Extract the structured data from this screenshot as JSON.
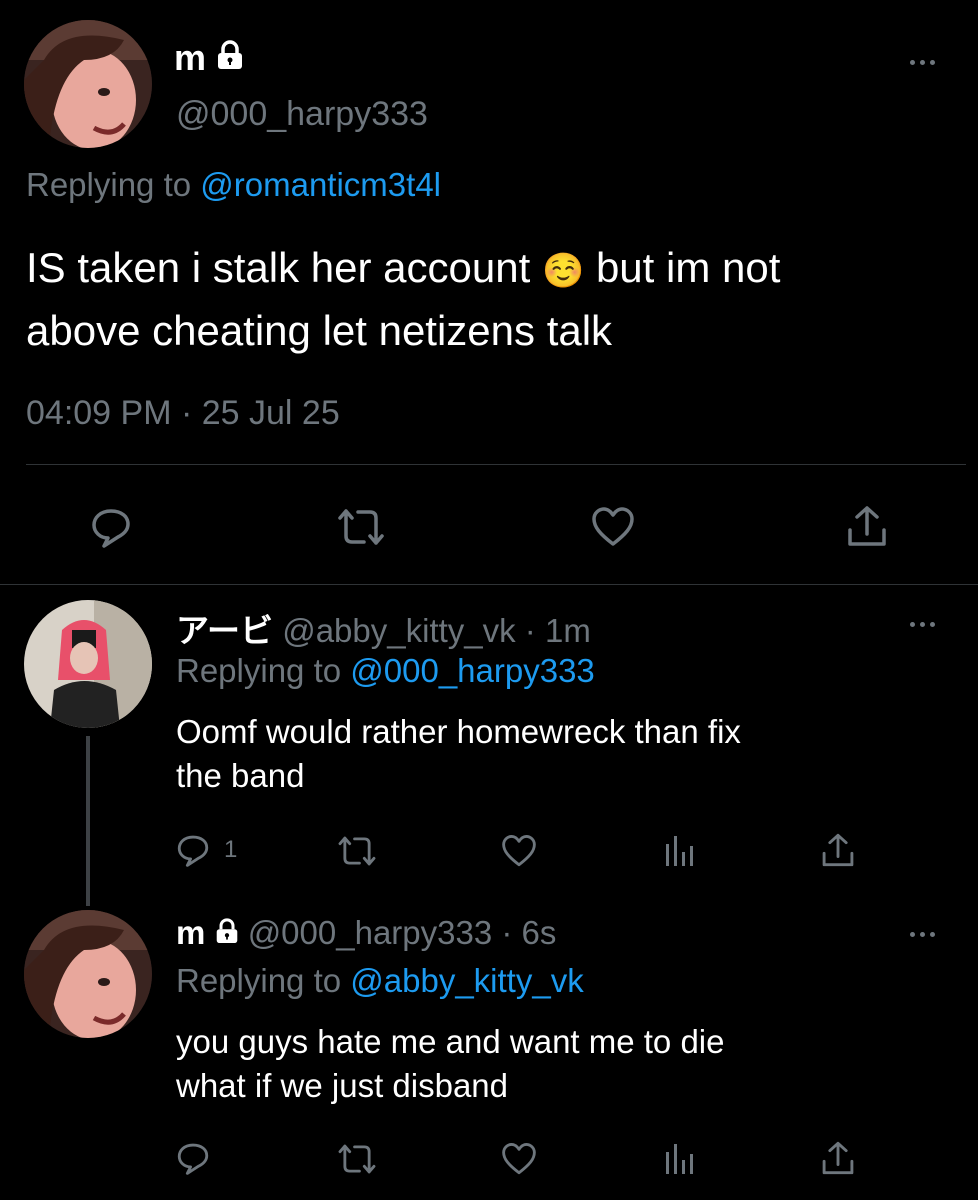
{
  "main_tweet": {
    "display_name": "m",
    "handle": "@000_harpy333",
    "replying_prefix": "Replying to ",
    "replying_to": "@romanticm3t4l",
    "text_line1_a": "IS taken i stalk her account ",
    "text_emoji": "☺️",
    "text_line1_b": " but im not",
    "text_line2": "above cheating let netizens talk",
    "timestamp": "04:09 PM · 25 Jul 25"
  },
  "reply_1": {
    "display_name": "アービ",
    "meta": "@abby_kitty_vk · 1m",
    "replying_prefix": "Replying to ",
    "replying_to": "@000_harpy333",
    "text_line1": "Oomf would rather homewreck than fix",
    "text_line2": "the band",
    "reply_count": "1"
  },
  "reply_2": {
    "display_name": "m",
    "meta": "@000_harpy333 · 6s",
    "replying_prefix": "Replying to ",
    "replying_to": "@abby_kitty_vk",
    "text_line1": "you guys hate me and want me to die",
    "text_line2": "what if we just disband"
  },
  "icons": [
    "lock-icon",
    "more-icon",
    "reply-icon",
    "retweet-icon",
    "like-icon",
    "analytics-icon",
    "share-icon"
  ],
  "colors": {
    "background": "#000000",
    "text": "#ffffff",
    "muted": "#6e767d",
    "link": "#1d9bf0",
    "divider": "#2f3336"
  }
}
